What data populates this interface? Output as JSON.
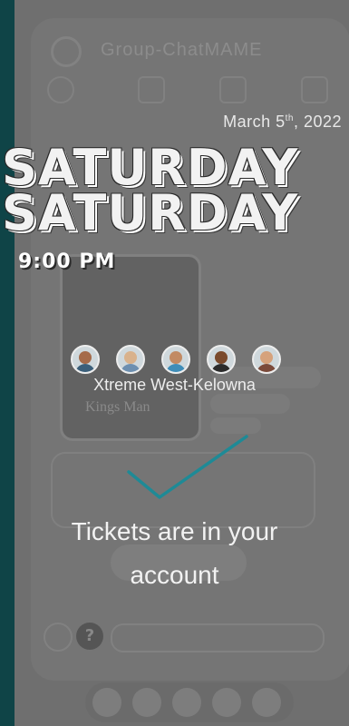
{
  "header": {
    "title": "Group-ChatMAME"
  },
  "event": {
    "date_prefix": "March 5",
    "date_suffix": "th",
    "date_year": ", 2022",
    "day": "SATURDAY",
    "time": "9:00 PM",
    "venue": "Xtreme West-Kelowna",
    "poster_text": "Kings Man"
  },
  "confirmation": {
    "line1": "Tickets are in your",
    "line2": "account"
  },
  "colors": {
    "background": "#0f4447",
    "overlay": "#6f6f6f",
    "check": "#1e8a96"
  },
  "avatars": [
    {
      "skin": "#a56b4a",
      "shirt": "#3b5f7a"
    },
    {
      "skin": "#d9b28c",
      "shirt": "#6d8fb0"
    },
    {
      "skin": "#c28a63",
      "shirt": "#3f8db8"
    },
    {
      "skin": "#7a4a2c",
      "shirt": "#2b2b2b"
    },
    {
      "skin": "#d6a27c",
      "shirt": "#7b4a3a"
    }
  ],
  "footer": {
    "help_label": "?"
  }
}
